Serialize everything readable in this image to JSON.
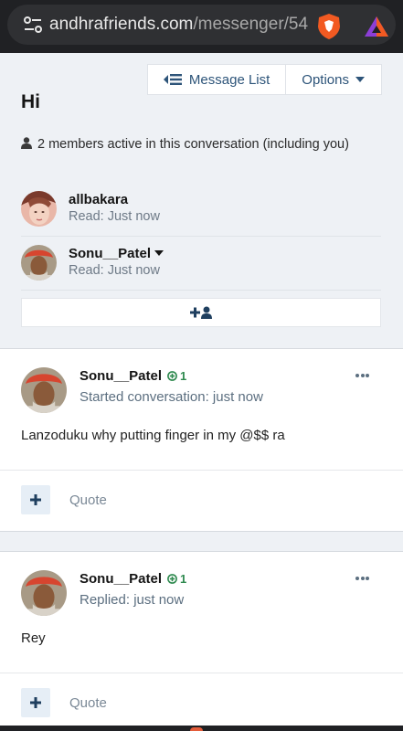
{
  "browser": {
    "url_main": "andhrafriends.com",
    "url_path": "/messenger/54",
    "icons": [
      "site-info-icon",
      "brave-shield-icon",
      "brave-rewards-icon"
    ]
  },
  "toolbar": {
    "message_list_label": "Message List",
    "options_label": "Options"
  },
  "conversation": {
    "title": "Hi",
    "members_text": "2 members active in this conversation (including you)"
  },
  "members": [
    {
      "name": "allbakara",
      "read": "Read: Just now"
    },
    {
      "name": "Sonu__Patel",
      "read": "Read: Just now"
    }
  ],
  "messages": [
    {
      "author": "Sonu__Patel",
      "reaction_score": "1",
      "subline": "Started conversation: just now",
      "body": "Lanzoduku why putting finger in my @$$ ra",
      "quote_label": "Quote"
    },
    {
      "author": "Sonu__Patel",
      "reaction_score": "1",
      "subline": "Replied: just now",
      "body": "Rey",
      "quote_label": "Quote"
    }
  ],
  "colors": {
    "accent": "#2d5479",
    "positive": "#2f8a4f",
    "page_bg": "#eef1f5"
  }
}
